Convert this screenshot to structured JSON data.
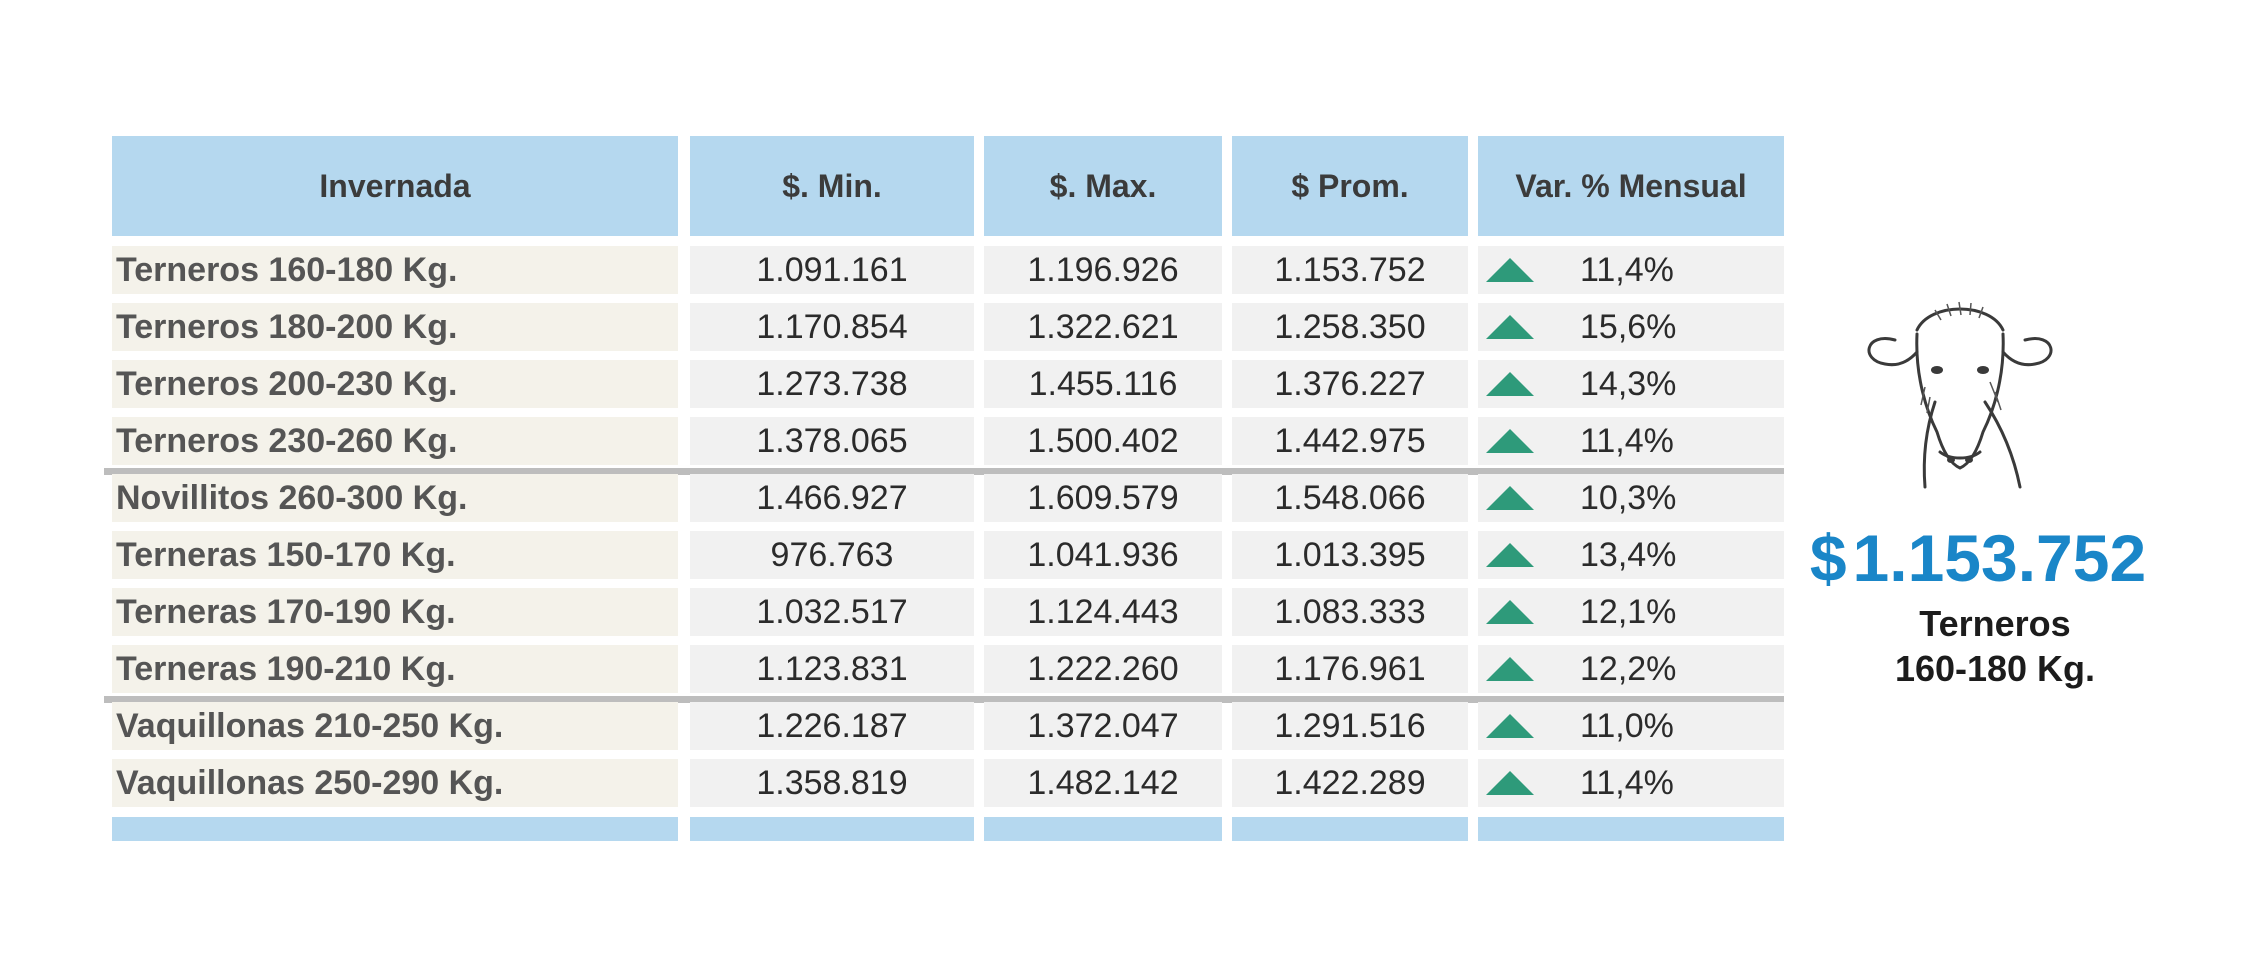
{
  "table": {
    "headers": [
      "Invernada",
      "$. Min.",
      "$. Max.",
      "$ Prom.",
      "Var. % Mensual"
    ],
    "rows": [
      {
        "name": "Terneros 160-180 Kg.",
        "min": "1.091.161",
        "max": "1.196.926",
        "prom": "1.153.752",
        "var": "11,4%"
      },
      {
        "name": "Terneros 180-200 Kg.",
        "min": "1.170.854",
        "max": "1.322.621",
        "prom": "1.258.350",
        "var": "15,6%"
      },
      {
        "name": "Terneros 200-230 Kg.",
        "min": "1.273.738",
        "max": "1.455.116",
        "prom": "1.376.227",
        "var": "14,3%"
      },
      {
        "name": "Terneros 230-260 Kg.",
        "min": "1.378.065",
        "max": "1.500.402",
        "prom": "1.442.975",
        "var": "11,4%"
      },
      {
        "name": "Novillitos 260-300 Kg.",
        "min": "1.466.927",
        "max": "1.609.579",
        "prom": "1.548.066",
        "var": "10,3%"
      },
      {
        "name": "Terneras 150-170 Kg.",
        "min": "976.763",
        "max": "1.041.936",
        "prom": "1.013.395",
        "var": "13,4%"
      },
      {
        "name": "Terneras 170-190 Kg.",
        "min": "1.032.517",
        "max": "1.124.443",
        "prom": "1.083.333",
        "var": "12,1%"
      },
      {
        "name": "Terneras 190-210 Kg.",
        "min": "1.123.831",
        "max": "1.222.260",
        "prom": "1.176.961",
        "var": "12,2%"
      },
      {
        "name": "Vaquillonas 210-250 Kg.",
        "min": "1.226.187",
        "max": "1.372.047",
        "prom": "1.291.516",
        "var": "11,0%"
      },
      {
        "name": "Vaquillonas 250-290 Kg.",
        "min": "1.358.819",
        "max": "1.482.142",
        "prom": "1.422.289",
        "var": "11,4%"
      }
    ],
    "trend_icon": "up-triangle-icon",
    "trend_color": "#2e9a7a"
  },
  "highlight": {
    "currency": "$",
    "price": "1.153.752",
    "caption_line1": "Terneros",
    "caption_line2": "160-180 Kg.",
    "image_icon": "cow-head-icon"
  },
  "colors": {
    "header_bg": "#b5d8ef",
    "name_bg": "#f4f2ea",
    "cell_bg": "#f1f1f1",
    "price_accent": "#1a86c8"
  }
}
